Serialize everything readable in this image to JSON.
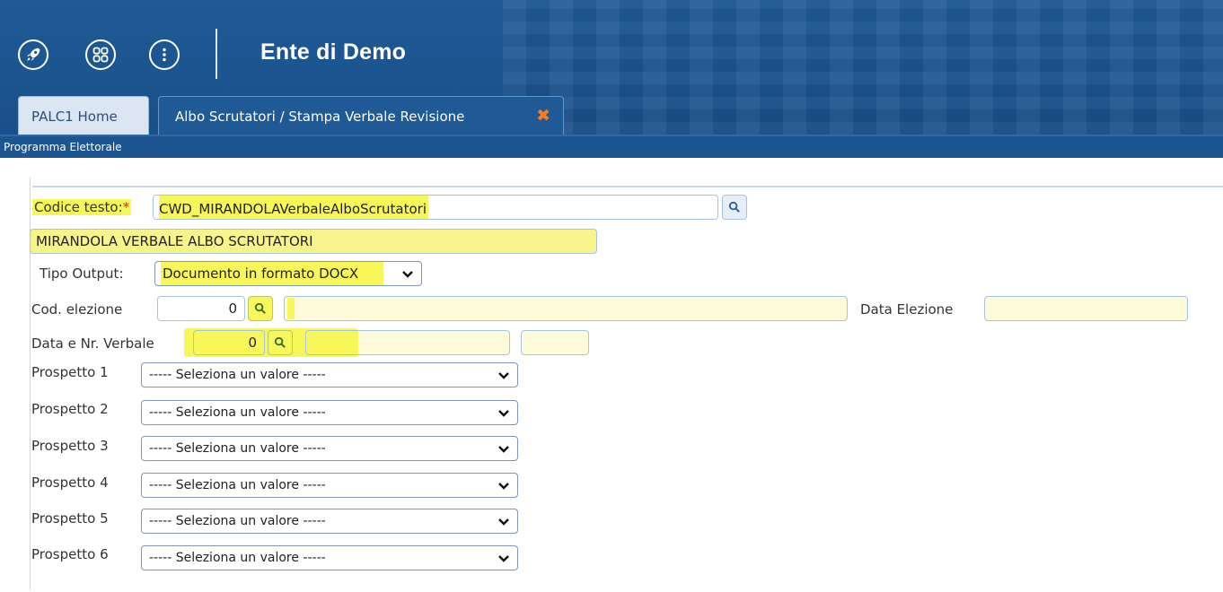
{
  "header": {
    "app_title": "Ente di Demo",
    "buttons": [
      {
        "icon": "rocket-icon"
      },
      {
        "icon": "apps-grid-icon"
      },
      {
        "icon": "more-vertical-icon"
      }
    ]
  },
  "tabs": [
    {
      "label": "PALC1 Home",
      "active": false
    },
    {
      "label": "Albo Scrutatori / Stampa Verbale Revisione",
      "active": true,
      "close_glyph": "✖"
    }
  ],
  "breadcrumb": "Programma Elettorale",
  "form": {
    "codice_testo": {
      "label": "Codice testo:",
      "required_mark": "*",
      "value": "CWD_MIRANDOLAVerbaleAlboScrutatori"
    },
    "descrizione": {
      "value": "MIRANDOLA VERBALE ALBO SCRUTATORI"
    },
    "tipo_output": {
      "label": "Tipo Output:",
      "value": "Documento in formato DOCX"
    },
    "cod_elezione": {
      "label": "Cod. elezione",
      "value": "0",
      "description": ""
    },
    "data_elezione": {
      "label": "Data Elezione",
      "value": ""
    },
    "data_nr_verbale": {
      "label": "Data e Nr. Verbale",
      "value": "0",
      "data": "",
      "numero": ""
    },
    "prospetti": [
      {
        "label": "Prospetto 1",
        "value": "----- Seleziona un valore -----"
      },
      {
        "label": "Prospetto 2",
        "value": "----- Seleziona un valore -----"
      },
      {
        "label": "Prospetto 3",
        "value": "----- Seleziona un valore -----"
      },
      {
        "label": "Prospetto 4",
        "value": "----- Seleziona un valore -----"
      },
      {
        "label": "Prospetto 5",
        "value": "----- Seleziona un valore -----"
      },
      {
        "label": "Prospetto 6",
        "value": "----- Seleziona un valore -----"
      }
    ]
  },
  "colors": {
    "header_bg": "#1f5a96",
    "highlight": "#f7f75a",
    "tab_close": "#ff7a1a",
    "required": "#e0262a",
    "readonly_field": "#fdfbd9"
  }
}
